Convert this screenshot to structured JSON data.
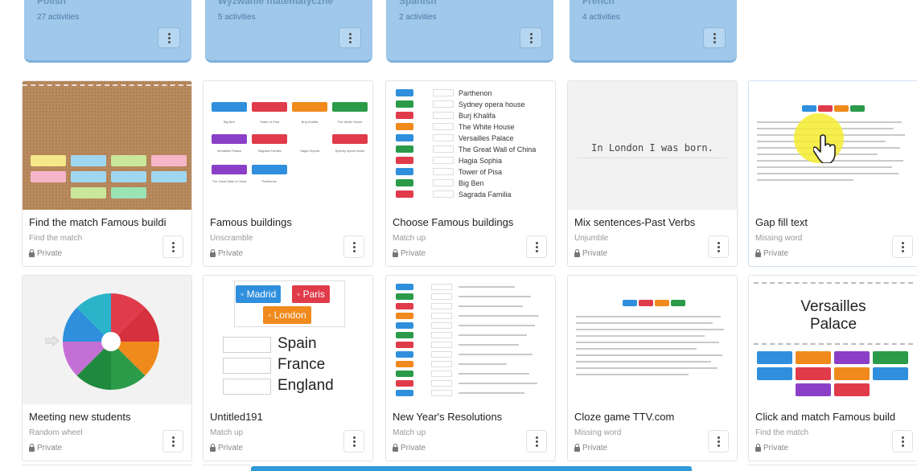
{
  "folders": [
    {
      "name": "Polish",
      "count": "27 activities"
    },
    {
      "name": "Wyzwanie matematyczne",
      "count": "5 activities"
    },
    {
      "name": "Spanish",
      "count": "2 activities"
    },
    {
      "name": "French",
      "count": "4 activities"
    }
  ],
  "cards": [
    {
      "title": "Find the match Famous buildi",
      "type": "Find the match",
      "privacy": "Private"
    },
    {
      "title": "Famous buildings",
      "type": "Unscramble",
      "privacy": "Private"
    },
    {
      "title": "Choose Famous buildings",
      "type": "Match up",
      "privacy": "Private"
    },
    {
      "title": "Mix sentences-Past Verbs",
      "type": "Unjumble",
      "privacy": "Private"
    },
    {
      "title": "Gap fill text",
      "type": "Missing word",
      "privacy": "Private"
    },
    {
      "title": "Meeting new students",
      "type": "Random wheel",
      "privacy": "Private"
    },
    {
      "title": "Untitled191",
      "type": "Match up",
      "privacy": "Private"
    },
    {
      "title": "New Year's Resolutions",
      "type": "Match up",
      "privacy": "Private"
    },
    {
      "title": "Cloze game TTV.com",
      "type": "Missing word",
      "privacy": "Private"
    },
    {
      "title": "Click and match Famous build",
      "type": "Find the match",
      "privacy": "Private"
    }
  ],
  "thumbs": {
    "famous_buildings_labels": [
      "Big Ben",
      "Tower of Pisa",
      "Burj Khalifa",
      "The White House",
      "Versailles Palace",
      "Sagrada Familia",
      "Hagia Sophia",
      "Sydney opera house",
      "The Great Wall of China",
      "Parthenon"
    ],
    "choose_list": [
      "Parthenon",
      "Sydney opera house",
      "Burj Khalifa",
      "The White House",
      "Versailles Palace",
      "The Great Wall of China",
      "Hagia Sophia",
      "Tower of Pisa",
      "Big Ben",
      "Sagrada Familia"
    ],
    "mix_sentence": "In London I was born.",
    "untitled_chips": [
      "Madrid",
      "Paris",
      "London"
    ],
    "untitled_words": [
      "Spain",
      "France",
      "England"
    ],
    "versailles_title": "Versailles Palace"
  },
  "colors": {
    "folder_bg": "#9fc8ea",
    "chip_blue": "#2f8fdc",
    "chip_red": "#e03b4a",
    "chip_orange": "#f08a1c",
    "cursor_highlight": "#f4ec2e"
  }
}
